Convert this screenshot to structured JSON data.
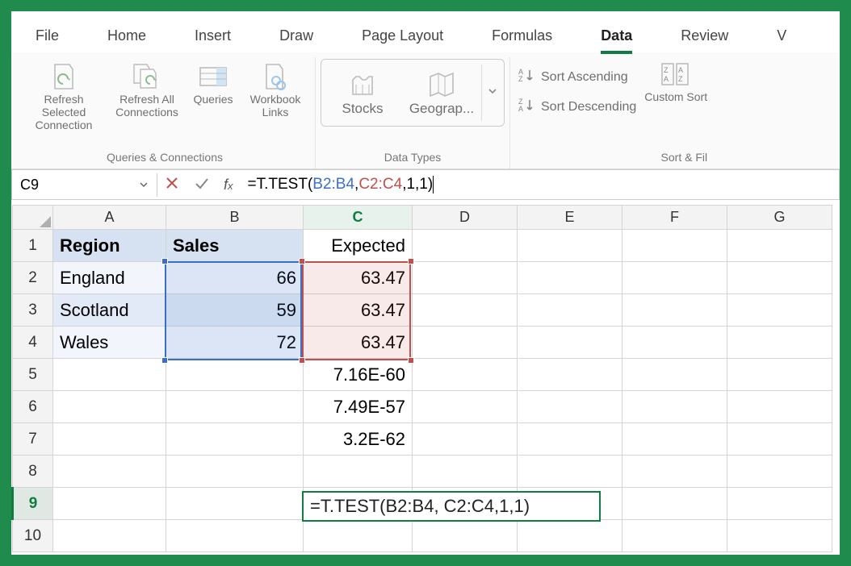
{
  "tabs": [
    "File",
    "Home",
    "Insert",
    "Draw",
    "Page Layout",
    "Formulas",
    "Data",
    "Review",
    "V"
  ],
  "activeTab": "Data",
  "ribbon": {
    "queries_connections_label": "Queries & Connections",
    "refresh_selected": "Refresh Selected Connection",
    "refresh_all": "Refresh All Connections",
    "queries": "Queries",
    "workbook_links": "Workbook Links",
    "stocks": "Stocks",
    "geography": "Geograp...",
    "data_types_label": "Data Types",
    "sort_asc": "Sort Ascending",
    "sort_desc": "Sort Descending",
    "custom_sort": "Custom Sort",
    "sort_filter_label": "Sort & Fil"
  },
  "nameBox": "C9",
  "formula": {
    "prefix": "=T.TEST(",
    "ref1": "B2:B4",
    "mid": ", ",
    "ref2": "C2:C4",
    "suffix": ",1,1)"
  },
  "columns": [
    "A",
    "B",
    "C",
    "D",
    "E",
    "F",
    "G"
  ],
  "rows": [
    "1",
    "2",
    "3",
    "4",
    "5",
    "6",
    "7",
    "8",
    "9",
    "10"
  ],
  "cells": {
    "A1": "Region",
    "B1": "Sales",
    "C1": "Expected",
    "A2": "England",
    "B2": "66",
    "C2": "63.47",
    "A3": "Scotland",
    "B3": "59",
    "C3": "63.47",
    "A4": "Wales",
    "B4": "72",
    "C4": "63.47",
    "C5": "7.16E-60",
    "C6": "7.49E-57",
    "C7": "3.2E-62"
  },
  "formulaCellText": "=T.TEST(B2:B4, C2:C4,1,1)",
  "chart_data": null
}
